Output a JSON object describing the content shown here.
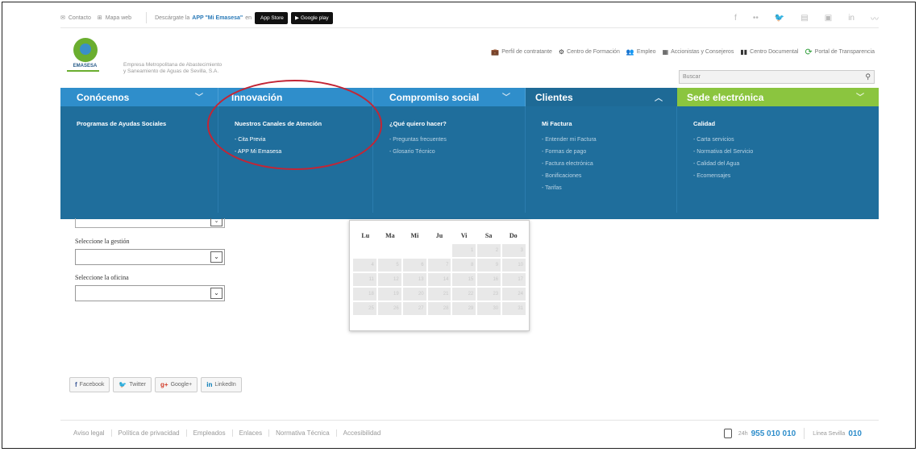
{
  "topbar": {
    "contacto": "Contacto",
    "mapa_web": "Mapa web",
    "download_text": "Descárgate la",
    "download_app": "APP \"Mi Emasesa\"",
    "download_en": "en",
    "app_store": "App Store",
    "google_play": "Google play",
    "social_icons": [
      "f",
      "••",
      "tw",
      "yt",
      "fl",
      "in",
      "rss"
    ]
  },
  "header": {
    "logo_text": "EMASESA",
    "company_line1": "Empresa Metropolitana de Abastecimiento",
    "company_line2": "y Saneamiento de Aguas de Sevilla, S.A.",
    "links": [
      {
        "icon": "briefcase-icon",
        "label": "Perfil de contratante"
      },
      {
        "icon": "gear-icon",
        "label": "Centro de Formación"
      },
      {
        "icon": "people-icon",
        "label": "Empleo"
      },
      {
        "icon": "grid-icon",
        "label": "Accionistas y Consejeros"
      },
      {
        "icon": "documents-icon",
        "label": "Centro Documental"
      },
      {
        "icon": "refresh-icon",
        "label": "Portal de Transparencia"
      }
    ],
    "search_placeholder": "Buscar"
  },
  "nav": {
    "items": [
      "Conócenos",
      "Innovación",
      "Compromiso social",
      "Clientes",
      "Sede electrónica"
    ]
  },
  "mega": {
    "columns": [
      {
        "title": "Programas de Ayudas Sociales",
        "links": []
      },
      {
        "title": "Nuestros Canales de Atención",
        "links": [
          "- Cita Previa",
          "- APP Mi Emasesa"
        ]
      },
      {
        "title": "¿Qué quiero hacer?",
        "links": [
          "- Preguntas frecuentes",
          "- Glosario Técnico"
        ]
      },
      {
        "title": "Mi Factura",
        "links": [
          "- Entender mi Factura",
          "- Formas de pago",
          "- Factura electrónica",
          "- Bonificaciones",
          "- Tarifas"
        ]
      },
      {
        "title": "Calidad",
        "links": [
          "- Carta servicios",
          "- Normativa del Servicio",
          "- Calidad del Agua",
          "- Ecomensajes"
        ]
      }
    ]
  },
  "form": {
    "gestion_label": "Seleccione la gestión",
    "oficina_label": "Seleccione la oficina"
  },
  "calendar": {
    "weekdays": [
      "Lu",
      "Ma",
      "Mi",
      "Ju",
      "Vi",
      "Sa",
      "Do"
    ],
    "days": [
      "",
      "",
      "",
      "",
      "1",
      "2",
      "3",
      "4",
      "5",
      "6",
      "7",
      "8",
      "9",
      "10",
      "11",
      "12",
      "13",
      "14",
      "15",
      "16",
      "17",
      "18",
      "19",
      "20",
      "21",
      "22",
      "23",
      "24",
      "25",
      "26",
      "27",
      "28",
      "29",
      "30",
      "31"
    ]
  },
  "share": {
    "facebook": "Facebook",
    "twitter": "Twitter",
    "googleplus": "Google+",
    "linkedin": "LinkedIn"
  },
  "footer": {
    "links": [
      "Aviso legal",
      "Política de privacidad",
      "Empleados",
      "Enlaces",
      "Normativa Técnica",
      "Accesibilidad"
    ],
    "phone_prefix": "24h",
    "phone_number": "955 010 010",
    "linea_label": "Línea Sevilla",
    "linea_number": "010"
  },
  "colors": {
    "nav_blue": "#2f8ecb",
    "nav_active": "#1e6a96",
    "nav_green": "#8bc53f",
    "highlight_ellipse": "#c32535"
  }
}
